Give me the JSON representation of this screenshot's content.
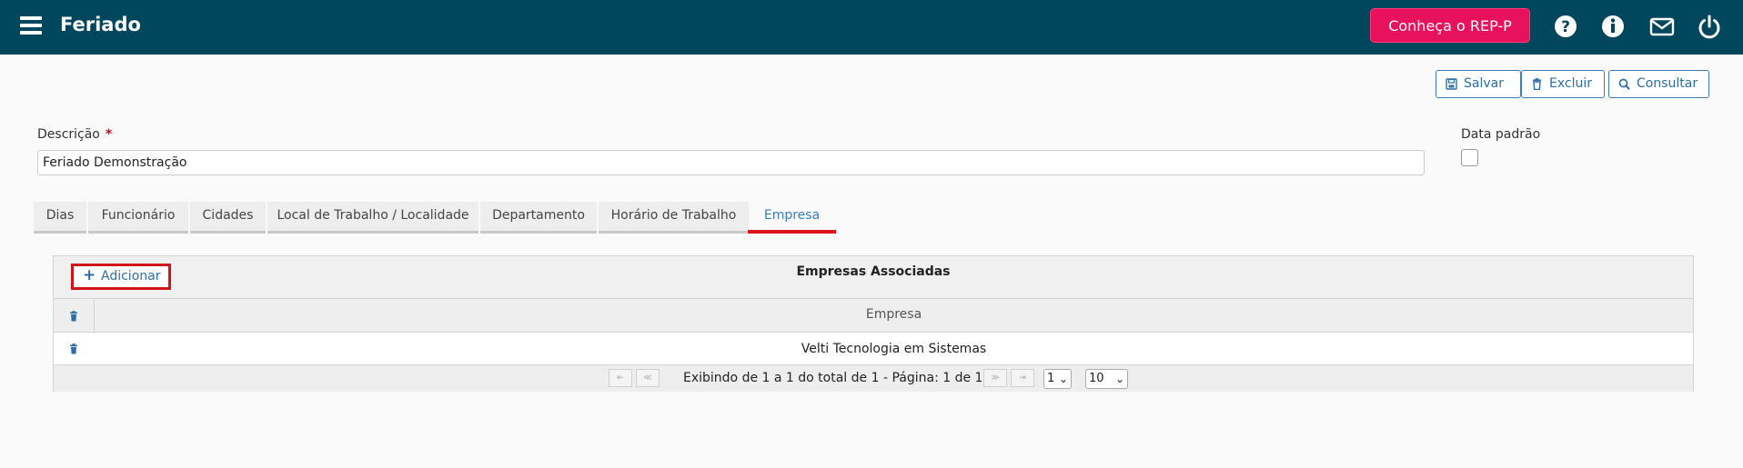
{
  "header": {
    "title": "Feriado",
    "cta_label": "Conheça o REP-P",
    "colors": {
      "bar": "#00475e",
      "cta": "#e8125c"
    },
    "icons": [
      "menu-icon",
      "help-icon",
      "info-icon",
      "mail-icon",
      "power-icon"
    ]
  },
  "toolbar": {
    "save_label": "Salvar",
    "delete_label": "Excluir",
    "search_label": "Consultar"
  },
  "form": {
    "description_label": "Descrição",
    "required_mark": "*",
    "description_value": "Feriado Demonstração",
    "default_date_label": "Data padrão",
    "default_date_checked": false
  },
  "tabs": [
    {
      "label": "Dias",
      "active": false
    },
    {
      "label": "Funcionário",
      "active": false
    },
    {
      "label": "Cidades",
      "active": false
    },
    {
      "label": "Local de Trabalho / Localidade",
      "active": false
    },
    {
      "label": "Departamento",
      "active": false
    },
    {
      "label": "Horário de Trabalho",
      "active": false
    },
    {
      "label": "Empresa",
      "active": true
    }
  ],
  "panel": {
    "title": "Empresas Associadas",
    "add_label": "Adicionar",
    "column_header": "Empresa",
    "rows": [
      {
        "empresa": "Velti Tecnologia em Sistemas"
      }
    ],
    "pager": {
      "first": "⇤",
      "prev": "≪",
      "next": "≫",
      "last": "⇥",
      "summary": "Exibindo de 1 a 1 do total de 1 - Página: 1 de 1",
      "page_selected": "1",
      "page_size_selected": "10"
    }
  }
}
